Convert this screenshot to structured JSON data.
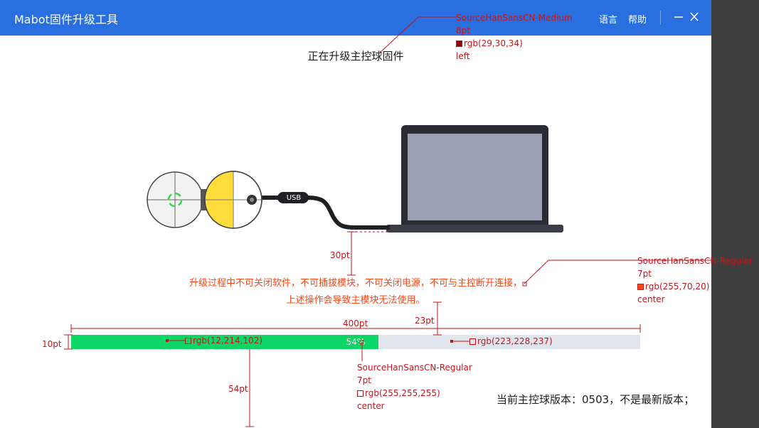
{
  "window": {
    "title": "Mabot固件升级工具",
    "menu": {
      "language": "语言",
      "help": "帮助"
    },
    "controls": {
      "minimize": "—",
      "close": "✕"
    }
  },
  "main": {
    "heading": "正在升级主控球固件",
    "usb_label": "USB",
    "warning_line1": "升级过程中不可关闭软件，不可插拔模块，不可关闭电源，不可与主控断开连接，",
    "warning_line2": "上述操作会导致主模块无法使用。",
    "progress": {
      "percent": 54,
      "label": "54%"
    },
    "version_text": "当前主控球版本：0503，不是最新版本；"
  },
  "colors": {
    "titlebar": "#2a6fe0",
    "heading": "#1d1e22",
    "warning": "#ff4614",
    "progress_fill": "#0cd666",
    "progress_track": "#dfe4ed",
    "laptop_screen": "#9aa0b4",
    "laptop_body": "#2a2b33",
    "ball_yellow": "#ffdc3c",
    "ring_green": "#3ad64a"
  },
  "annotations": {
    "heading_spec": {
      "font": "SourceHanSansCN-Medium",
      "size": "8pt",
      "color": "rgb(29,30,34)",
      "align": "left"
    },
    "warning_spec": {
      "font": "SourceHanSansCN-Regular",
      "size": "7pt",
      "color": "rgb(255,70,20)",
      "align": "center"
    },
    "progress_text_spec": {
      "font": "SourceHanSansCN-Regular",
      "size": "7pt",
      "color": "rgb(255,255,255)",
      "align": "center"
    },
    "fill_color": "rgb(12,214,102)",
    "track_color": "rgb(223,228,237)",
    "dim_30": "30pt",
    "dim_23": "23pt",
    "dim_400": "400pt",
    "dim_10": "10pt",
    "dim_54": "54pt"
  }
}
